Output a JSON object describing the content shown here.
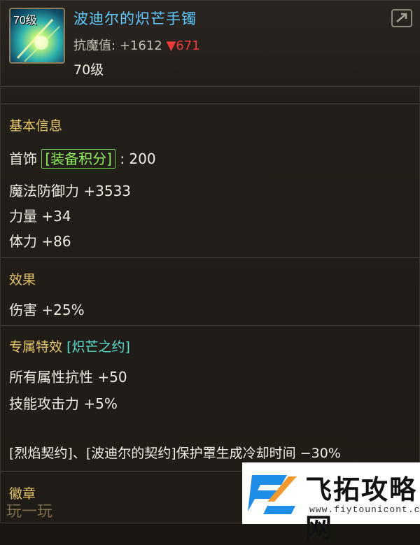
{
  "item": {
    "icon_level_badge": "70级",
    "name": "波迪尔的炽芒手镯",
    "stat_label": "抗魔值:",
    "stat_value": "+1612",
    "stat_down": "▼671",
    "level": "70级"
  },
  "basic": {
    "title": "基本信息",
    "slot": "首饰",
    "score_tag": "[装备积分]",
    "score_value": ": 200",
    "lines": [
      "魔法防御力 +3533",
      "力量 +34",
      "体力 +86"
    ]
  },
  "effect": {
    "title": "效果",
    "lines": [
      "伤害 +25%"
    ]
  },
  "exclusive": {
    "title": "专属特效",
    "tag": "[炽芒之约]",
    "lines": [
      "所有属性抗性 +50",
      "技能攻击力 +5%"
    ],
    "note": "[烈焰契约]、[波迪尔的契约]保护罩生成冷却时间 −30%"
  },
  "badge": {
    "title": "徽章"
  },
  "watermark": {
    "left_text": "玩一玩",
    "title": "飞拓攻略网",
    "url": "www.fiytounicont.com"
  },
  "colors": {
    "name": "#5fc9ff",
    "section": "#e8c76b",
    "tag_green": "#8ff05c",
    "tag_cyan": "#59e0cf",
    "down": "#f03a3a"
  },
  "icons": {
    "share": "share-icon",
    "item": "bracelet-item-icon"
  }
}
